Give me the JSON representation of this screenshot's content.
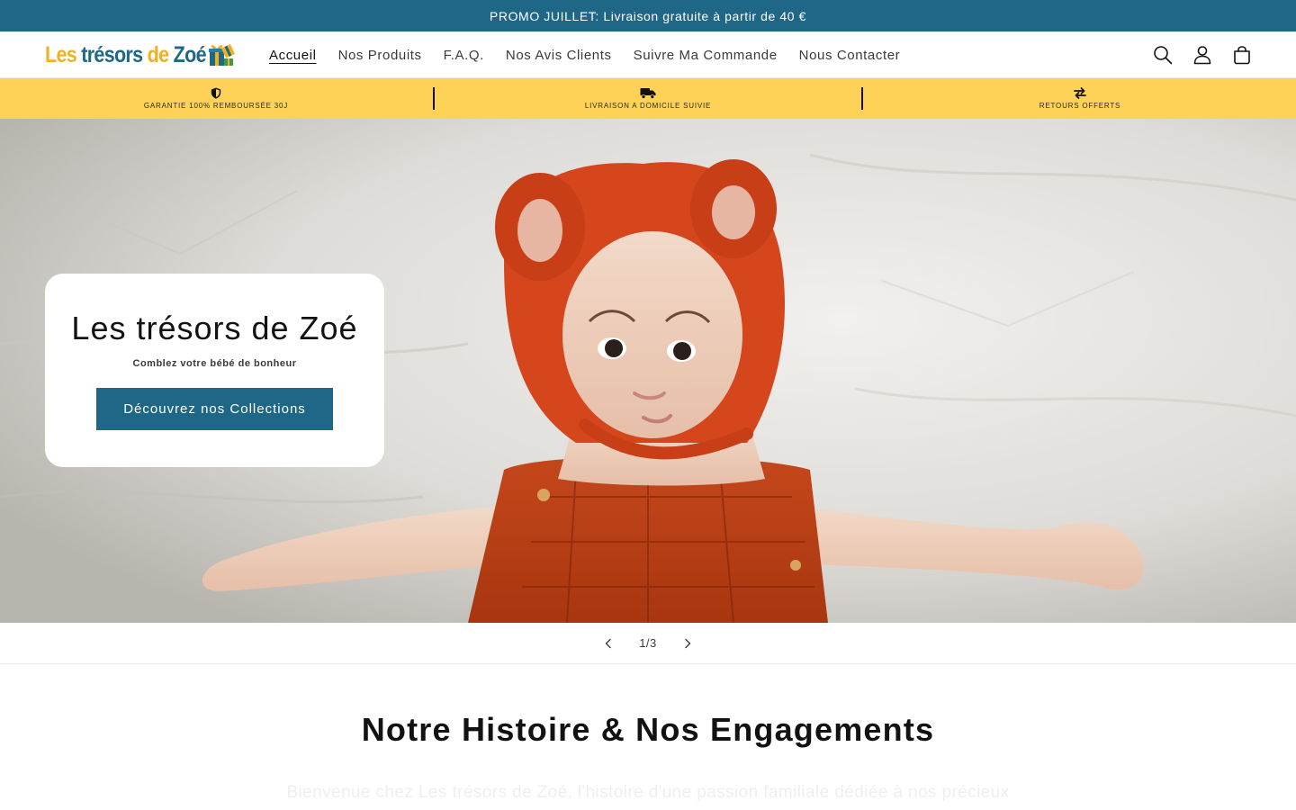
{
  "promo": {
    "text": "PROMO JUILLET: Livraison gratuite à partir de 40 €"
  },
  "header": {
    "logo": {
      "les": "Les",
      "tresors": "trésors",
      "de": "de",
      "zoe": "Zoé"
    },
    "nav": [
      {
        "label": "Accueil",
        "active": true
      },
      {
        "label": "Nos Produits"
      },
      {
        "label": "F.A.Q."
      },
      {
        "label": "Nos Avis Clients"
      },
      {
        "label": "Suivre Ma Commande"
      },
      {
        "label": "Nous Contacter"
      }
    ],
    "icons": [
      "search-icon",
      "account-icon",
      "cart-icon"
    ]
  },
  "trust": [
    {
      "icon": "shield-icon",
      "label": "GARANTIE 100% REMBOURSÉE 30J"
    },
    {
      "icon": "truck-icon",
      "label": "LIVRAISON A DOMICILE SUIVIE"
    },
    {
      "icon": "exchange-arrows-icon",
      "label": "RETOURS OFFERTS"
    }
  ],
  "hero": {
    "title": "Les trésors de Zoé",
    "subtitle": "Comblez votre bébé de bonheur",
    "button_label": "Découvrez nos Collections",
    "image": "baby-in-fox-hat-photo"
  },
  "slider": {
    "counter": "1/3",
    "current": 1,
    "total": 3
  },
  "section": {
    "title": "Notre Histoire & Nos Engagements",
    "text": "Bienvenue chez Les trésors de Zoé, l'histoire d'une passion familiale dédiée à nos précieux"
  },
  "colors": {
    "brand_blue": "#1f6786",
    "brand_yellow": "#fdd257",
    "logo_yellow": "#efb21e"
  }
}
